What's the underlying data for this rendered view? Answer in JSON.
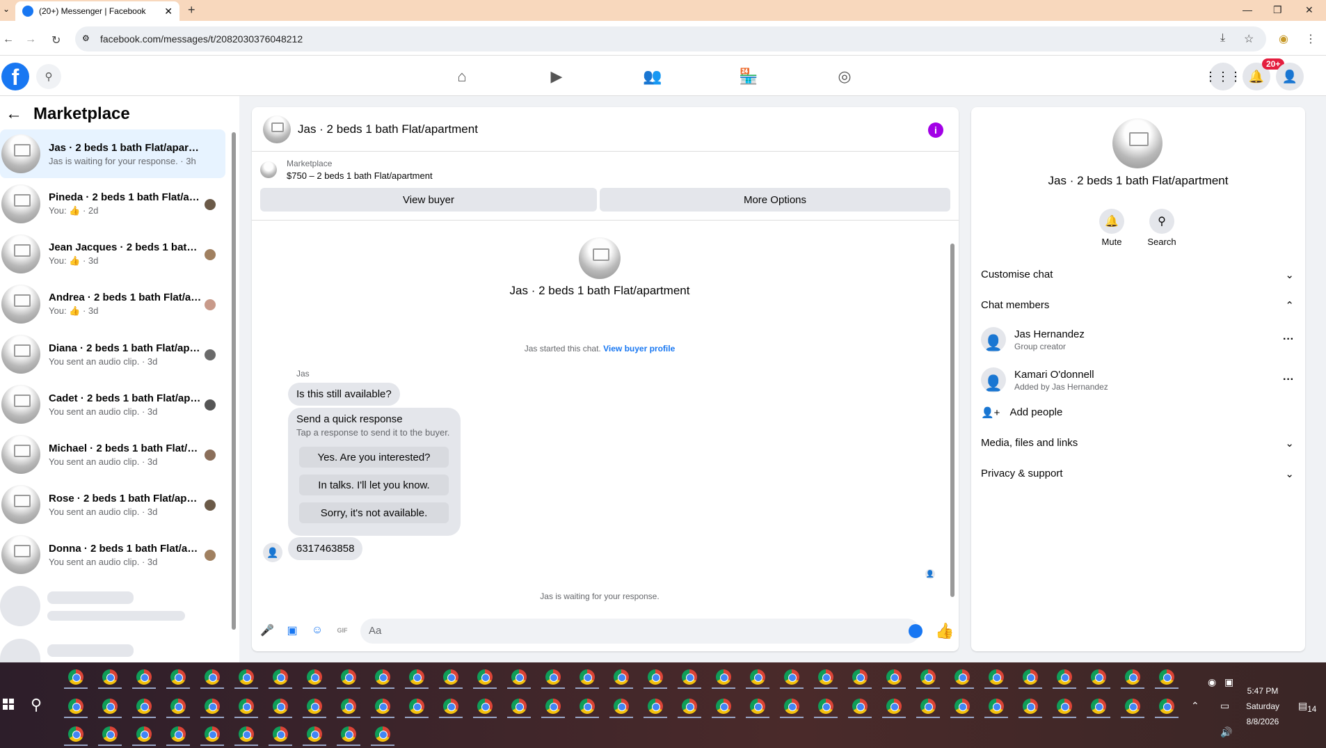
{
  "browser": {
    "tab_title": "(20+) Messenger | Facebook",
    "url": "facebook.com/messages/t/2082030376048212"
  },
  "header": {
    "logo": "f",
    "notif_badge": "20+"
  },
  "left": {
    "title": "Marketplace",
    "conversations": [
      {
        "name": "Jas · 2 beds 1 bath Flat/apartment",
        "sub": "Jas is waiting for your response. · 3h"
      },
      {
        "name": "Pineda · 2 beds 1 bath Flat/ap...",
        "sub": "You: 👍 · 2d"
      },
      {
        "name": "Jean Jacques · 2 beds 1 bath F...",
        "sub": "You: 👍 · 3d"
      },
      {
        "name": "Andrea · 2 beds 1 bath Flat/ap...",
        "sub": "You: 👍 · 3d"
      },
      {
        "name": "Diana · 2 beds 1 bath Flat/apa...",
        "sub": "You sent an audio clip. · 3d"
      },
      {
        "name": "Cadet · 2 beds 1 bath Flat/apa...",
        "sub": "You sent an audio clip. · 3d"
      },
      {
        "name": "Michael · 2 beds 1 bath Flat/a...",
        "sub": "You sent an audio clip. · 3d"
      },
      {
        "name": "Rose · 2 beds 1 bath Flat/apartm...",
        "sub": "You sent an audio clip. · 3d"
      },
      {
        "name": "Donna · 2 beds 1 bath Flat/apart...",
        "sub": "You sent an audio clip. · 3d"
      }
    ]
  },
  "chat": {
    "title": "Jas · 2 beds 1 bath Flat/apartment",
    "marketplace_label": "Marketplace",
    "listing": "$750 – 2 beds 1 bath Flat/apartment",
    "view_buyer": "View buyer",
    "more_options": "More Options",
    "center_title": "Jas · 2 beds 1 bath Flat/apartment",
    "started": "Jas started this chat.",
    "view_profile": "View buyer profile",
    "sender": "Jas",
    "msg1": "Is this still available?",
    "quick_title": "Send a quick response",
    "quick_sub": "Tap a response to send it to the buyer.",
    "quick_options": [
      "Yes. Are you interested?",
      "In talks. I'll let you know.",
      "Sorry, it's not available."
    ],
    "msg2": "6317463858",
    "waiting": "Jas is waiting for your response.",
    "placeholder": "Aa"
  },
  "info": {
    "title": "Jas · 2 beds 1 bath Flat/apartment",
    "mute": "Mute",
    "search": "Search",
    "customise": "Customise chat",
    "members_label": "Chat members",
    "members": [
      {
        "name": "Jas Hernandez",
        "role": "Group creator"
      },
      {
        "name": "Kamari O'donnell",
        "role": "Added by Jas Hernandez"
      }
    ],
    "add_people": "Add people",
    "media": "Media, files and links",
    "privacy": "Privacy & support"
  },
  "taskbar": {
    "time": "5:47 PM",
    "day": "Saturday",
    "date": "8/8/2026",
    "notif_count": "14"
  }
}
